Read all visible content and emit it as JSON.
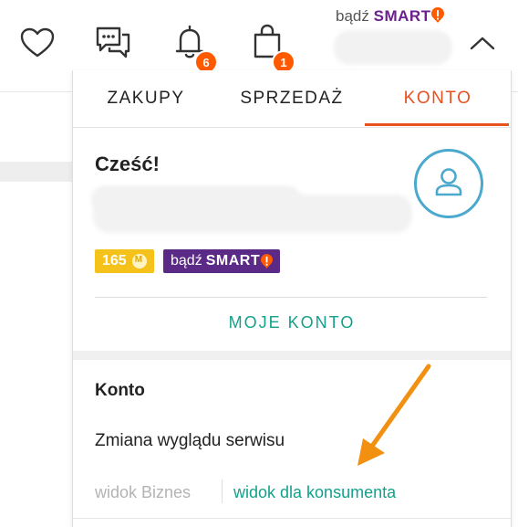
{
  "header": {
    "icons": [
      "heart-icon",
      "chat-icon",
      "bell-icon",
      "bag-icon",
      "chevron-up-icon"
    ],
    "notifications_count": "6",
    "cart_count": "1",
    "smart_prefix": "bądź",
    "smart_word": "SMART",
    "smart_mark": "!"
  },
  "tabs": [
    {
      "label": "ZAKUPY"
    },
    {
      "label": "SPRZEDAŻ"
    },
    {
      "label": "KONTO"
    }
  ],
  "account": {
    "greeting": "Cześć!",
    "coins": "165",
    "smart_prefix": "bądź",
    "smart_word": "SMART",
    "smart_mark": "!",
    "my_account": "MOJE KONTO"
  },
  "settings": {
    "section_title": "Konto",
    "appearance_label": "Zmiana wyglądu serwisu",
    "view_business": "widok Biznes",
    "view_consumer": "widok dla konsumenta"
  },
  "colors": {
    "accent_orange": "#e8511e",
    "teal_link": "#14a08a",
    "smart_purple": "#5b2a86",
    "coin_yellow": "#f4c21b",
    "badge_orange": "#ff5a00",
    "annotation_arrow": "#f29111"
  }
}
